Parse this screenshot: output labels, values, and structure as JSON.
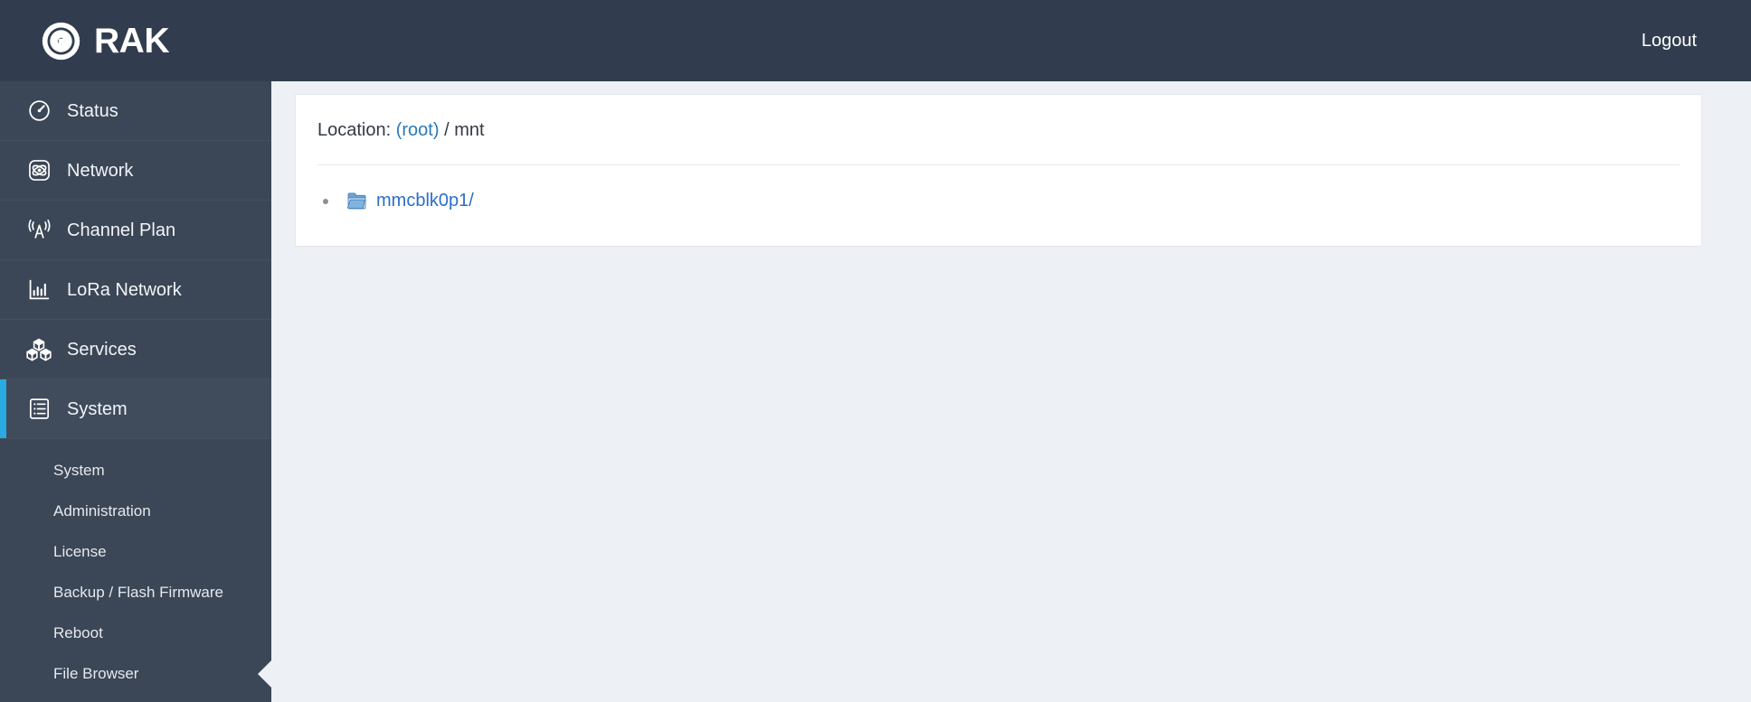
{
  "header": {
    "brand": "RAK",
    "logo_icon": "rak-pinwheel-logo",
    "logout_label": "Logout",
    "background_color": "#313d4f"
  },
  "sidebar": {
    "background_color": "#3b4656",
    "accent_color": "#29abe2",
    "items": [
      {
        "label": "Status",
        "icon": "speedometer-icon",
        "active": false
      },
      {
        "label": "Network",
        "icon": "atom-icon",
        "active": false
      },
      {
        "label": "Channel Plan",
        "icon": "antenna-icon",
        "active": false
      },
      {
        "label": "LoRa Network",
        "icon": "bar-chart-icon",
        "active": false
      },
      {
        "label": "Services",
        "icon": "boxes-icon",
        "active": false
      },
      {
        "label": "System",
        "icon": "list-document-icon",
        "active": true
      }
    ],
    "submenu": [
      {
        "label": "System",
        "selected": false
      },
      {
        "label": "Administration",
        "selected": false
      },
      {
        "label": "License",
        "selected": false
      },
      {
        "label": "Backup / Flash Firmware",
        "selected": false
      },
      {
        "label": "Reboot",
        "selected": false
      },
      {
        "label": "File Browser",
        "selected": true
      }
    ]
  },
  "main": {
    "location": {
      "label": "Location:",
      "root_link": "(root)",
      "separator": "/",
      "current": "mnt"
    },
    "entries": [
      {
        "name": "mmcblk0p1/",
        "icon": "folder-icon",
        "type": "directory"
      }
    ]
  },
  "colors": {
    "page_background": "#edf0f4",
    "card_background": "#ffffff",
    "link": "#2a6fc9",
    "folder": "#5b9bd5"
  }
}
